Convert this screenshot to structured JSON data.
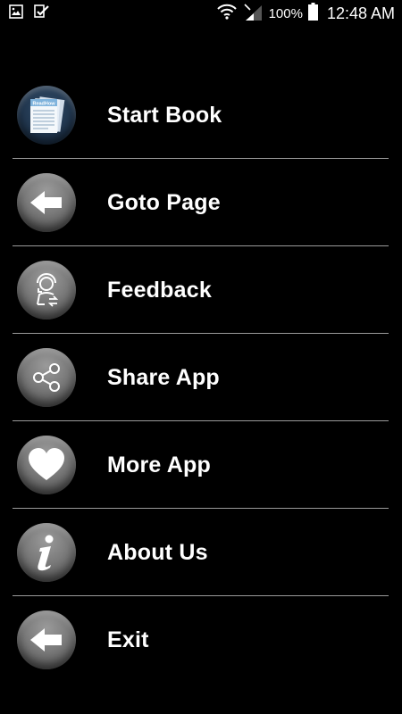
{
  "status_bar": {
    "battery_percent": "100%",
    "time": "12:48 AM"
  },
  "book_cover_text": "ReadHow",
  "menu": [
    {
      "label": "Start Book",
      "icon": "book-icon"
    },
    {
      "label": "Goto Page",
      "icon": "arrow-left-icon"
    },
    {
      "label": "Feedback",
      "icon": "support-agent-icon"
    },
    {
      "label": "Share App",
      "icon": "share-icon"
    },
    {
      "label": "More App",
      "icon": "heart-icon"
    },
    {
      "label": "About Us",
      "icon": "info-icon"
    },
    {
      "label": "Exit",
      "icon": "arrow-left-icon"
    }
  ]
}
